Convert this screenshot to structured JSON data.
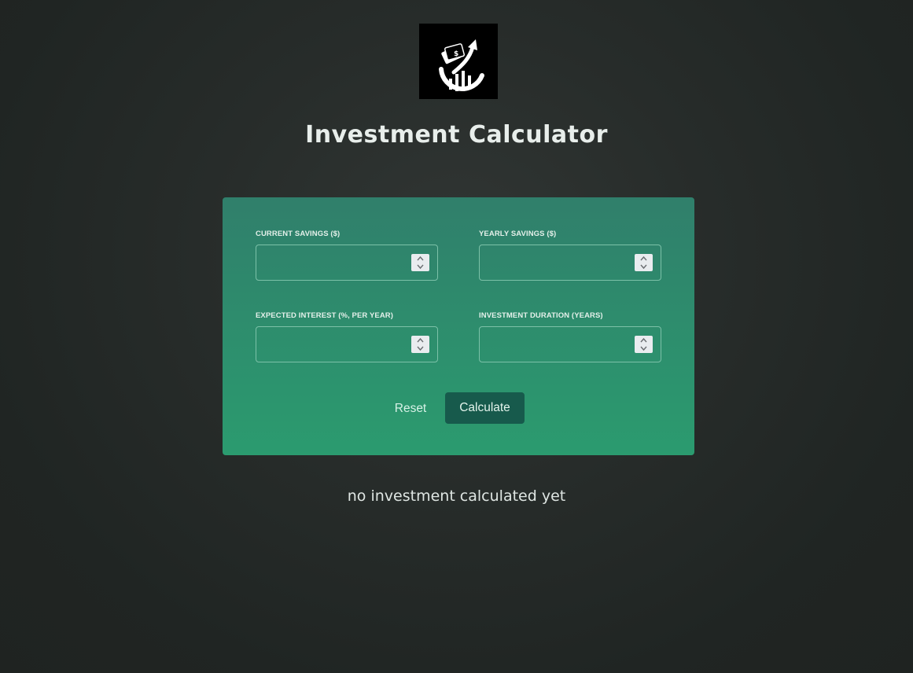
{
  "header": {
    "logo_icon": "investment-growth-logo",
    "title": "Investment Calculator"
  },
  "form": {
    "fields": [
      {
        "label": "CURRENT SAVINGS ($)",
        "value": "",
        "placeholder": ""
      },
      {
        "label": "YEARLY SAVINGS ($)",
        "value": "",
        "placeholder": ""
      },
      {
        "label": "EXPECTED INTEREST (%, PER YEAR)",
        "value": "",
        "placeholder": ""
      },
      {
        "label": "INVESTMENT DURATION (YEARS)",
        "value": "",
        "placeholder": ""
      }
    ],
    "reset_label": "Reset",
    "calculate_label": "Calculate"
  },
  "result": {
    "status_text": "no investment calculated yet"
  },
  "colors": {
    "background": "#262b29",
    "card_top": "#307f6b",
    "card_bottom": "#2b9b6f",
    "calculate_button": "#175a4c"
  }
}
